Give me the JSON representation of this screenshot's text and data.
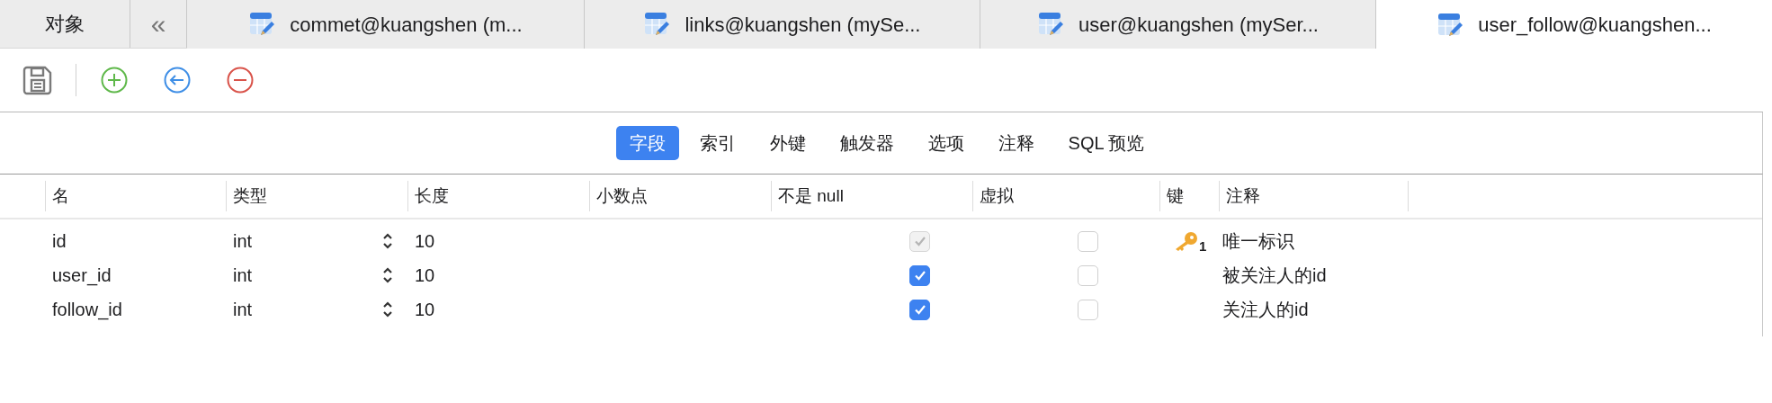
{
  "object_tab": "对象",
  "collapse_button": "«",
  "tabs": [
    {
      "label": "commet@kuangshen (m...",
      "selected": false
    },
    {
      "label": "links@kuangshen (mySe...",
      "selected": false
    },
    {
      "label": "user@kuangshen (mySer...",
      "selected": false
    },
    {
      "label": "user_follow@kuangshen...",
      "selected": true
    }
  ],
  "subtabs": [
    {
      "label": "字段",
      "selected": true
    },
    {
      "label": "索引",
      "selected": false
    },
    {
      "label": "外键",
      "selected": false
    },
    {
      "label": "触发器",
      "selected": false
    },
    {
      "label": "选项",
      "selected": false
    },
    {
      "label": "注释",
      "selected": false
    },
    {
      "label": "SQL 预览",
      "selected": false
    }
  ],
  "table": {
    "columns": [
      "名",
      "类型",
      "长度",
      "小数点",
      "不是 null",
      "虚拟",
      "键",
      "注释"
    ],
    "rows": [
      {
        "name": "id",
        "type": "int",
        "length": "10",
        "not_null": {
          "checked": true,
          "disabled": true
        },
        "virtual": {
          "checked": false
        },
        "key": "1",
        "comment": "唯一标识"
      },
      {
        "name": "user_id",
        "type": "int",
        "length": "10",
        "not_null": {
          "checked": true,
          "disabled": false
        },
        "virtual": {
          "checked": false
        },
        "comment": "被关注人的id"
      },
      {
        "name": "follow_id",
        "type": "int",
        "length": "10",
        "not_null": {
          "checked": true,
          "disabled": false
        },
        "virtual": {
          "checked": false
        },
        "comment": "关注人的id"
      }
    ]
  }
}
